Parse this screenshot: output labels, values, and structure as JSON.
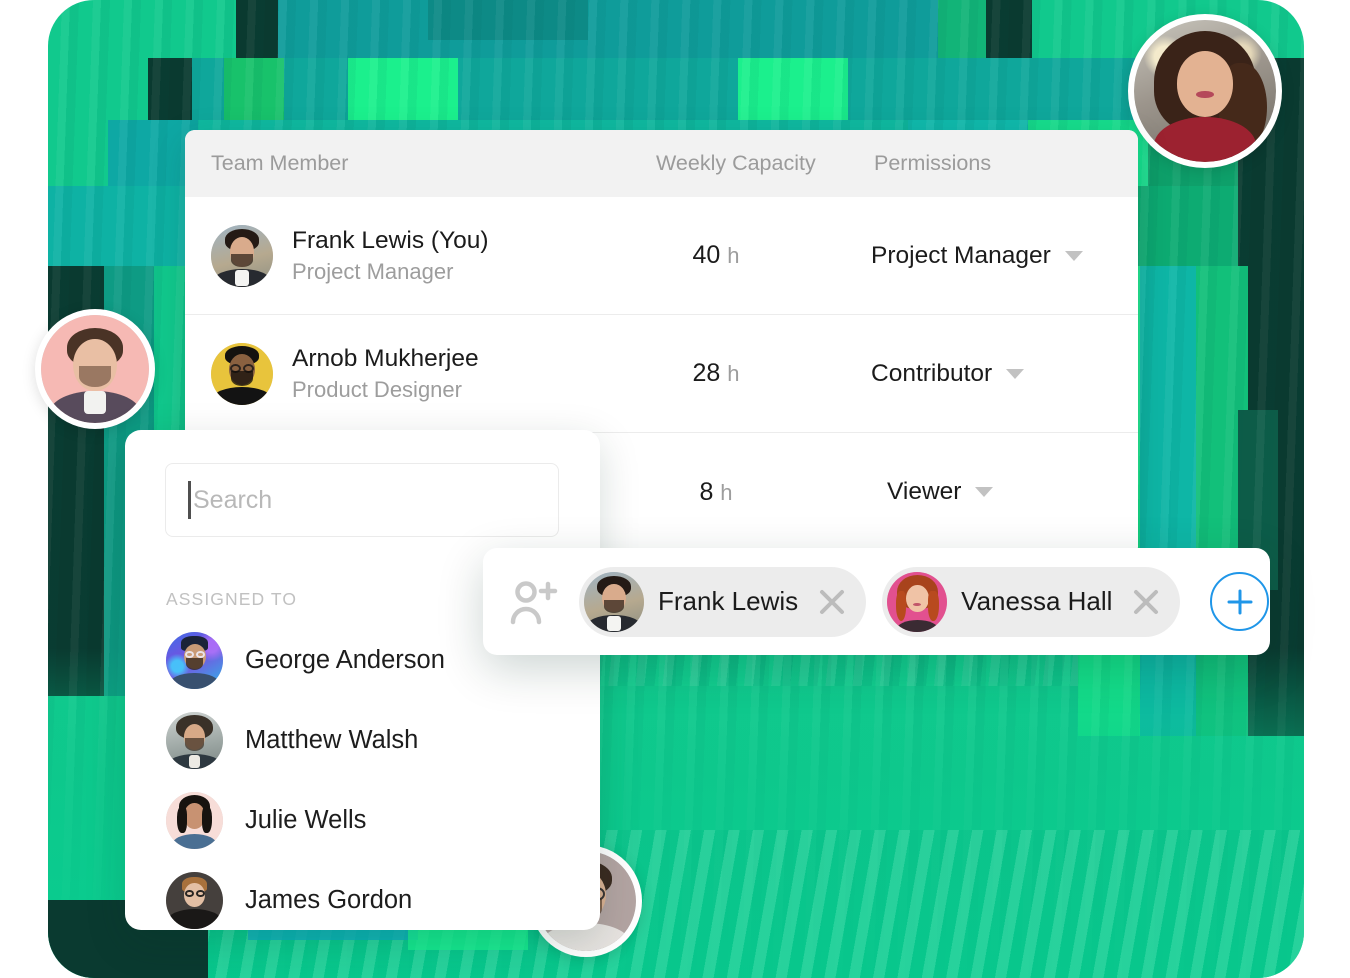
{
  "theme": {
    "accent_blue": "#1f96e8",
    "bg_green": "#12c98d",
    "bg_teal": "#0f9e9a",
    "bg_dark_green": "#0b3b30",
    "header_gray": "#f2f2f2",
    "chip_gray": "#ececec",
    "text_dark": "#1b1b1b",
    "text_muted": "#9d9d9d"
  },
  "team_table": {
    "columns": [
      {
        "key": "member",
        "label": "Team Member"
      },
      {
        "key": "capacity",
        "label": "Weekly Capacity"
      },
      {
        "key": "perm",
        "label": "Permissions"
      }
    ],
    "rows": [
      {
        "name": "Frank Lewis (You)",
        "role": "Project Manager",
        "capacity_value": "40",
        "capacity_unit": "h",
        "permission": "Project Manager",
        "avatar": "frank-lewis-avatar"
      },
      {
        "name": "Arnob Mukherjee",
        "role": "Product Designer",
        "capacity_value": "28",
        "capacity_unit": "h",
        "permission": "Contributor",
        "avatar": "arnob-mukherjee-avatar"
      },
      {
        "name": "",
        "role": "",
        "capacity_value": "8",
        "capacity_unit": "h",
        "permission": "Viewer",
        "avatar": "hidden-avatar"
      }
    ]
  },
  "assign_panel": {
    "search": {
      "placeholder": "Search",
      "value": ""
    },
    "section_label": "ASSIGNED TO",
    "people": [
      {
        "name": "George Anderson",
        "avatar": "george-anderson-avatar"
      },
      {
        "name": "Matthew Walsh",
        "avatar": "matthew-walsh-avatar"
      },
      {
        "name": "Julie Wells",
        "avatar": "julie-wells-avatar"
      },
      {
        "name": "James Gordon",
        "avatar": "james-gordon-avatar"
      }
    ]
  },
  "chip_bar": {
    "lead_icon": "person-add-icon",
    "chips": [
      {
        "name": "Frank Lewis",
        "avatar": "frank-lewis-avatar",
        "remove_icon": "close-icon"
      },
      {
        "name": "Vanessa Hall",
        "avatar": "vanessa-hall-avatar",
        "remove_icon": "close-icon"
      }
    ],
    "add_button": {
      "icon": "plus-icon",
      "label": "+"
    }
  },
  "floating_avatars": [
    {
      "name": "top-right-avatar",
      "icon": "avatar-woman-red-top"
    },
    {
      "name": "left-avatar",
      "icon": "avatar-man-pink-bg"
    },
    {
      "name": "bottom-avatar",
      "icon": "avatar-man-glasses"
    }
  ]
}
